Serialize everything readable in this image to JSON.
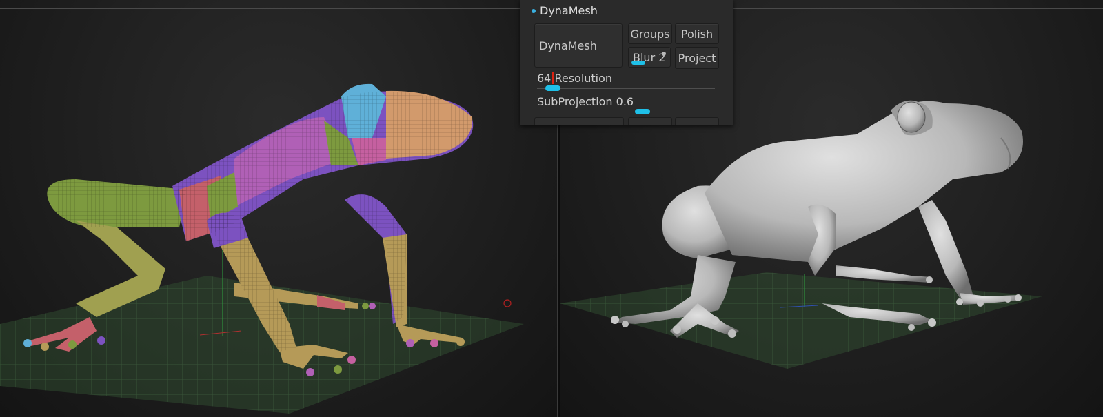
{
  "panel": {
    "title": "DynaMesh",
    "buttons": {
      "dynamesh": "DynaMesh",
      "groups": "Groups",
      "polish": "Polish",
      "blur": "Blur 2",
      "project": "Project"
    },
    "resolution": {
      "value": "64",
      "label": "Resolution",
      "fraction": 0.05
    },
    "subprojection": {
      "label": "SubProjection 0.6",
      "fraction": 0.6
    }
  },
  "colors": {
    "accent_slider": "#1fc0e8",
    "panel_bg": "#2a2a2a",
    "mesh_green": "#7d9a3f",
    "mesh_yellow": "#b59a58",
    "mesh_purple": "#7c52c0",
    "mesh_magenta": "#b060b6",
    "mesh_pink": "#c4606a",
    "mesh_orange": "#d29a6c",
    "mesh_cyan": "#5fb0d8",
    "sculpt_gray": "#c4c4c4"
  },
  "viewports": {
    "left_model": "polygroup-colored-frog-mesh",
    "right_model": "dynamesh-gray-frog-sculpt"
  }
}
